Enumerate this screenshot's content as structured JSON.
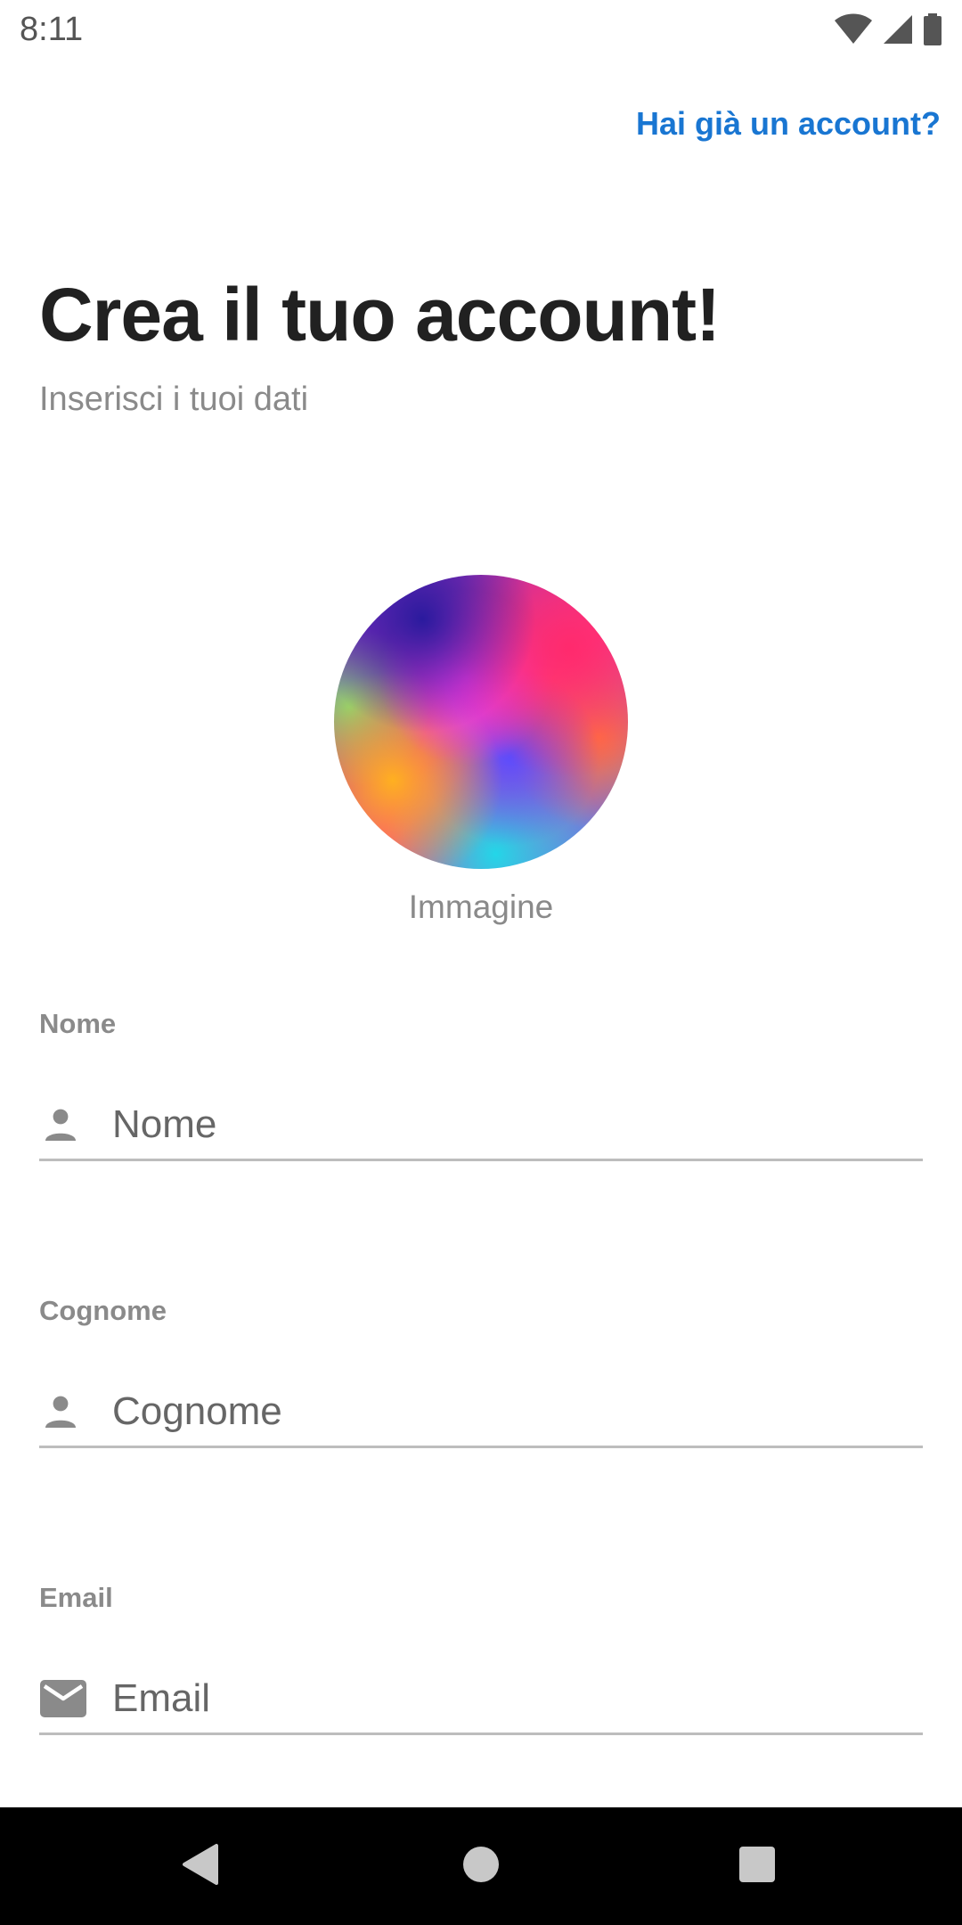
{
  "status_bar": {
    "time": "8:11",
    "icons": [
      "wifi-icon",
      "cellular-signal-icon",
      "battery-icon"
    ]
  },
  "header": {
    "login_link": "Hai già un account?"
  },
  "main": {
    "title": "Crea il tuo account!",
    "subtitle": "Inserisci i tuoi dati",
    "avatar_label": "Immagine",
    "fields": {
      "name": {
        "label": "Nome",
        "placeholder": "Nome",
        "value": "",
        "icon": "person-icon"
      },
      "surname": {
        "label": "Cognome",
        "placeholder": "Cognome",
        "value": "",
        "icon": "person-icon"
      },
      "email": {
        "label": "Email",
        "placeholder": "Email",
        "value": "",
        "icon": "mail-icon"
      }
    }
  },
  "nav_bar": {
    "buttons": [
      "back-icon",
      "home-icon",
      "recents-icon"
    ]
  },
  "colors": {
    "accent": "#1976d2",
    "muted_text": "#8a8a8a",
    "underline": "#bdbdbd",
    "nav_background": "#000000"
  }
}
